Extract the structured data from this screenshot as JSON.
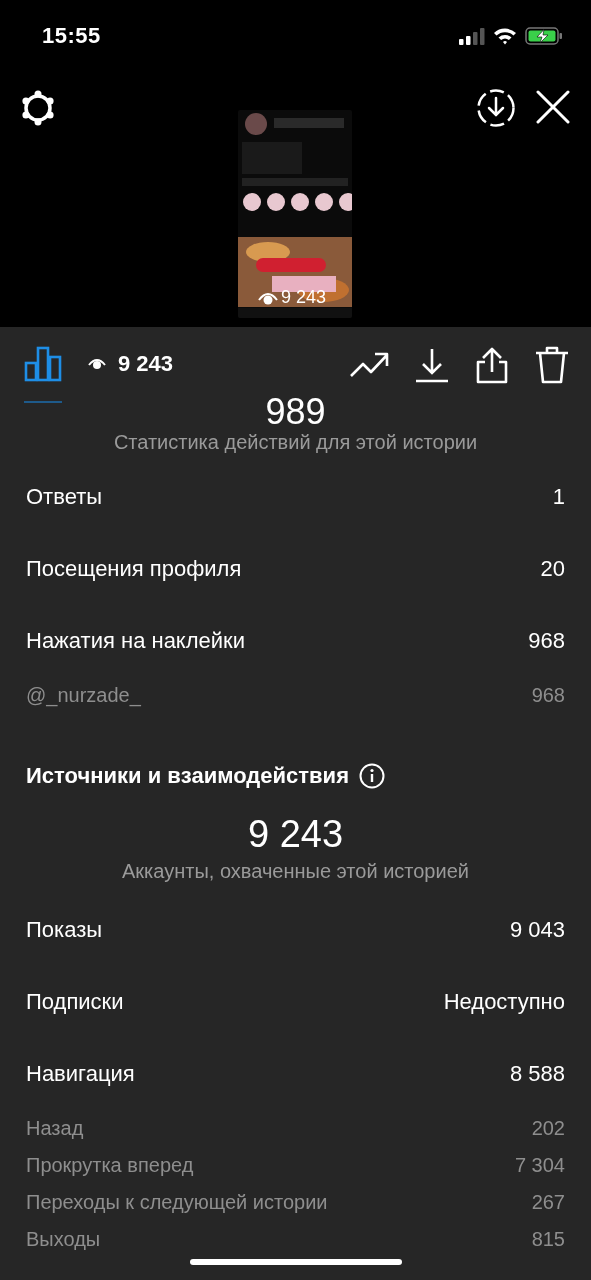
{
  "status_bar": {
    "time": "15:55"
  },
  "story_preview": {
    "kind": "picture",
    "views": "9 243"
  },
  "tabs": [
    {
      "kind": "insights",
      "selected": true
    },
    {
      "kind": "viewers",
      "label": "9 243",
      "selected": false
    }
  ],
  "sections": [
    {
      "total": "989",
      "caption": "Статистика действий для этой истории",
      "rows": [
        {
          "kind": "main",
          "label": "Ответы",
          "value": "1"
        },
        {
          "kind": "main",
          "label": "Посещения профиля",
          "value": "20"
        },
        {
          "kind": "main",
          "label": "Нажатия на наклейки",
          "value": "968"
        },
        {
          "kind": "sub",
          "label": "@_nurzade_",
          "value": "968"
        }
      ]
    },
    {
      "heading": "Источники и взаимодействия",
      "total": "9 243",
      "caption": "Аккаунты, охваченные этой историей",
      "rows": [
        {
          "kind": "main",
          "label": "Показы",
          "value": "9 043"
        },
        {
          "kind": "main",
          "label": "Подписки",
          "value": "Недоступно"
        },
        {
          "kind": "main",
          "label": "Навигация",
          "value": "8 588"
        },
        {
          "kind": "sub",
          "label": "Назад",
          "value": "202"
        },
        {
          "kind": "sub",
          "label": "Прокрутка вперед",
          "value": "7 304"
        },
        {
          "kind": "sub",
          "label": "Переходы к следующей истории",
          "value": "267"
        },
        {
          "kind": "sub",
          "label": "Выходы",
          "value": "815"
        }
      ]
    }
  ]
}
